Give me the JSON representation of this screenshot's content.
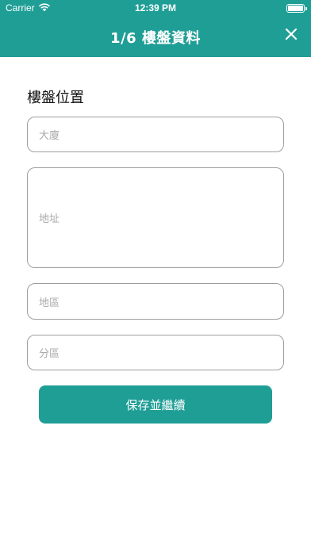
{
  "status_bar": {
    "carrier": "Carrier",
    "time": "12:39 PM"
  },
  "nav": {
    "title": "1/6 樓盤資料"
  },
  "form": {
    "section_title": "樓盤位置",
    "fields": {
      "building": {
        "placeholder": "大廈"
      },
      "address": {
        "placeholder": "地址"
      },
      "district": {
        "placeholder": "地區"
      },
      "area": {
        "placeholder": "分區"
      }
    },
    "save_label": "保存並繼續"
  },
  "colors": {
    "accent": "#1f9e96",
    "field_border": "#9e9e9e",
    "placeholder": "#a9a9a9"
  },
  "icons": {
    "wifi": "wifi-icon",
    "battery": "battery-icon",
    "close": "close-icon"
  }
}
